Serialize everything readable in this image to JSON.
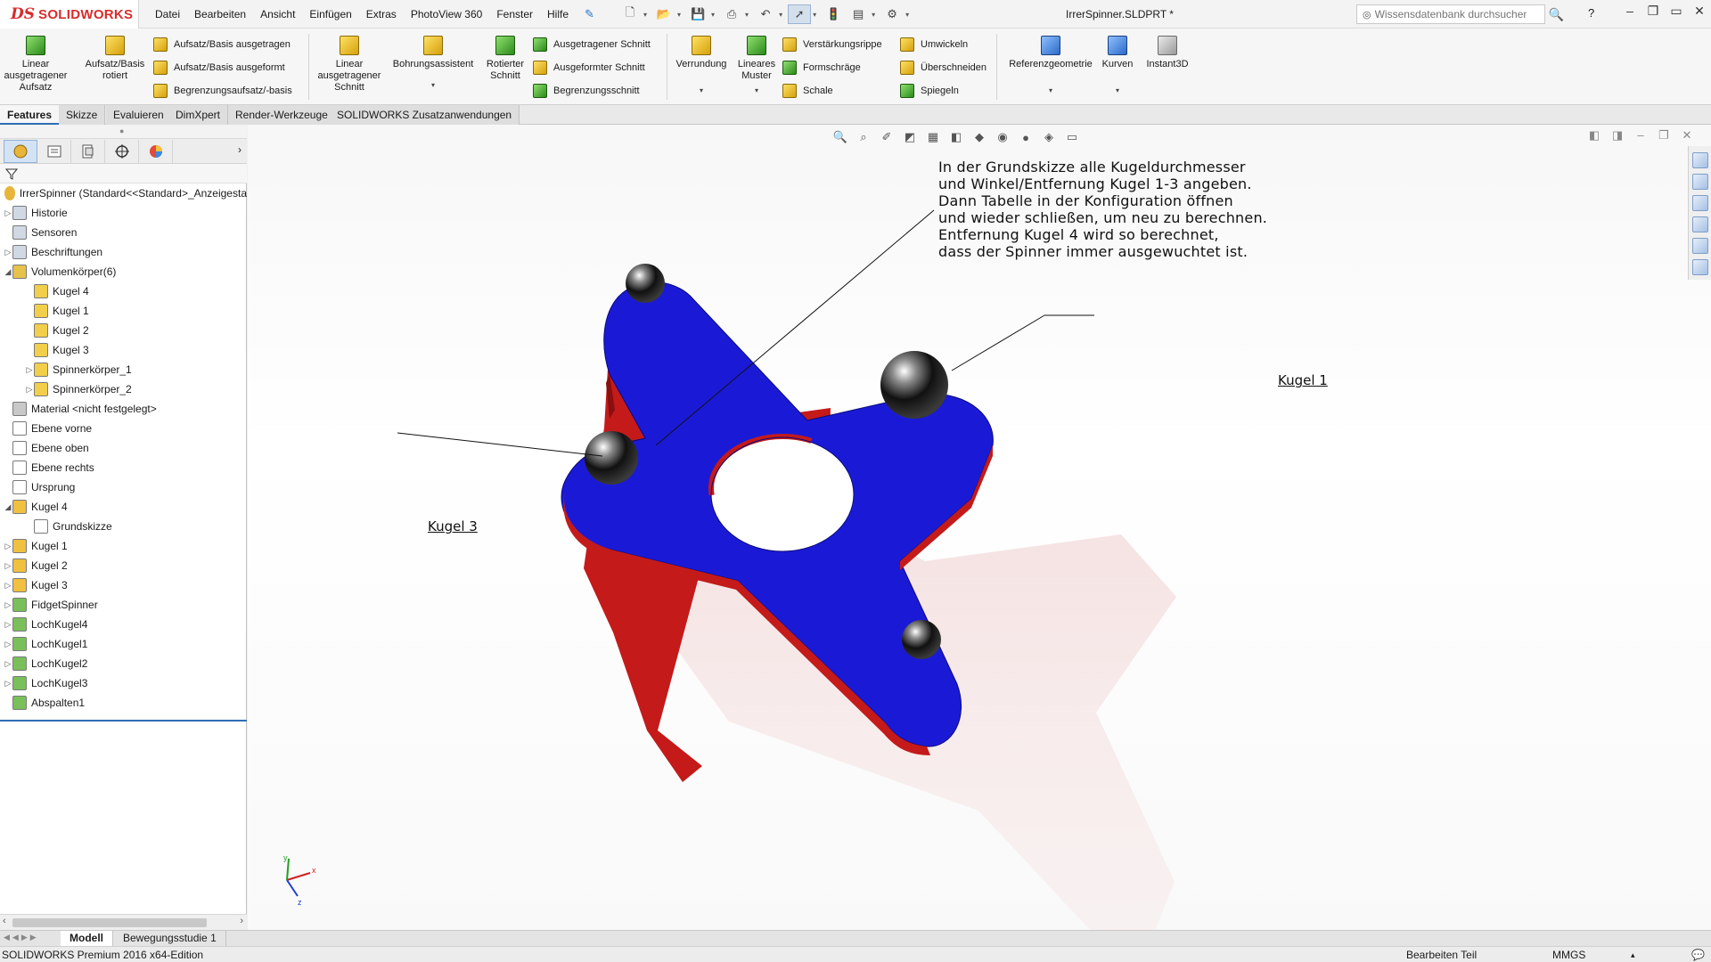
{
  "app": {
    "logo_ds": "DS",
    "logo_text": "SOLIDWORKS",
    "menu": [
      "Datei",
      "Bearbeiten",
      "Ansicht",
      "Einfügen",
      "Extras",
      "PhotoView 360",
      "Fenster",
      "Hilfe"
    ],
    "doc_title": "IrrerSpinner.SLDPRT *",
    "search_placeholder": "Wissensdatenbank durchsuchen",
    "help_label": "?"
  },
  "ribbon": {
    "linear_boss": "Linear ausgetragener Aufsatz",
    "revolve_boss": "Aufsatz/Basis rotiert",
    "sweep_boss": "Aufsatz/Basis ausgetragen",
    "loft_boss": "Aufsatz/Basis ausgeformt",
    "boundary_boss": "Begrenzungsaufsatz/-basis",
    "linear_cut": "Linear ausgetragener Schnitt",
    "hole_wizard": "Bohrungsassistent",
    "revolve_cut": "Rotierter Schnitt",
    "swept_cut": "Ausgetragener Schnitt",
    "lofted_cut": "Ausgeformter Schnitt",
    "boundary_cut": "Begrenzungsschnitt",
    "fillet": "Verrundung",
    "linear_pattern": "Lineares Muster",
    "rib": "Verstärkungsrippe",
    "draft": "Formschräge",
    "shell": "Schale",
    "wrap": "Umwickeln",
    "intersect": "Überschneiden",
    "mirror": "Spiegeln",
    "ref_geometry": "Referenzgeometrie",
    "curves": "Kurven",
    "instant3d": "Instant3D"
  },
  "tabs": [
    "Features",
    "Skizze",
    "Evaluieren",
    "DimXpert",
    "Render-Werkzeuge",
    "SOLIDWORKS Zusatzanwendungen"
  ],
  "tree": {
    "root": "IrrerSpinner  (Standard<<Standard>_Anzeigesta",
    "items": [
      {
        "label": "Historie",
        "indent": 1,
        "exp": "▷",
        "icon": "history-icon",
        "color": "#d0d8e4"
      },
      {
        "label": "Sensoren",
        "indent": 1,
        "exp": "",
        "icon": "sensor-icon",
        "color": "#d0d8e4"
      },
      {
        "label": "Beschriftungen",
        "indent": 1,
        "exp": "▷",
        "icon": "annotation-icon",
        "color": "#d0d8e4"
      },
      {
        "label": "Volumenkörper(6)",
        "indent": 1,
        "exp": "◢",
        "icon": "solid-bodies-icon",
        "color": "#e6c24a"
      },
      {
        "label": "Kugel 4",
        "indent": 2,
        "exp": "",
        "icon": "body-icon",
        "color": "#f2cf4a"
      },
      {
        "label": "Kugel 1",
        "indent": 2,
        "exp": "",
        "icon": "body-icon",
        "color": "#f2cf4a"
      },
      {
        "label": "Kugel 2",
        "indent": 2,
        "exp": "",
        "icon": "body-icon",
        "color": "#f2cf4a"
      },
      {
        "label": "Kugel 3",
        "indent": 2,
        "exp": "",
        "icon": "body-icon",
        "color": "#f2cf4a"
      },
      {
        "label": "Spinnerkörper_1",
        "indent": 2,
        "exp": "▷",
        "icon": "body-icon",
        "color": "#f2cf4a"
      },
      {
        "label": "Spinnerkörper_2",
        "indent": 2,
        "exp": "▷",
        "icon": "body-icon",
        "color": "#f2cf4a"
      },
      {
        "label": "Material <nicht festgelegt>",
        "indent": 1,
        "exp": "",
        "icon": "material-icon",
        "color": "#c8c8c8"
      },
      {
        "label": "Ebene vorne",
        "indent": 1,
        "exp": "",
        "icon": "plane-icon",
        "color": "#ffffff"
      },
      {
        "label": "Ebene oben",
        "indent": 1,
        "exp": "",
        "icon": "plane-icon",
        "color": "#ffffff"
      },
      {
        "label": "Ebene rechts",
        "indent": 1,
        "exp": "",
        "icon": "plane-icon",
        "color": "#ffffff"
      },
      {
        "label": "Ursprung",
        "indent": 1,
        "exp": "",
        "icon": "origin-icon",
        "color": "#ffffff"
      },
      {
        "label": "Kugel 4",
        "indent": 1,
        "exp": "◢",
        "icon": "revolve-icon",
        "color": "#f0c040"
      },
      {
        "label": "Grundskizze",
        "indent": 2,
        "exp": "",
        "icon": "sketch-icon",
        "color": "#ffffff"
      },
      {
        "label": "Kugel 1",
        "indent": 1,
        "exp": "▷",
        "icon": "revolve-icon",
        "color": "#f0c040"
      },
      {
        "label": "Kugel 2",
        "indent": 1,
        "exp": "▷",
        "icon": "revolve-icon",
        "color": "#f0c040"
      },
      {
        "label": "Kugel 3",
        "indent": 1,
        "exp": "▷",
        "icon": "revolve-icon",
        "color": "#f0c040"
      },
      {
        "label": "FidgetSpinner",
        "indent": 1,
        "exp": "▷",
        "icon": "extrude-icon",
        "color": "#7ac05a"
      },
      {
        "label": "LochKugel4",
        "indent": 1,
        "exp": "▷",
        "icon": "cut-icon",
        "color": "#7ac05a"
      },
      {
        "label": "LochKugel1",
        "indent": 1,
        "exp": "▷",
        "icon": "cut-icon",
        "color": "#7ac05a"
      },
      {
        "label": "LochKugel2",
        "indent": 1,
        "exp": "▷",
        "icon": "cut-icon",
        "color": "#7ac05a"
      },
      {
        "label": "LochKugel3",
        "indent": 1,
        "exp": "▷",
        "icon": "cut-icon",
        "color": "#7ac05a"
      },
      {
        "label": "Abspalten1",
        "indent": 1,
        "exp": "",
        "icon": "split-icon",
        "color": "#7ac05a"
      }
    ]
  },
  "viewport": {
    "note_lines": [
      "In der Grundskizze alle Kugeldurchmesser",
      "und Winkel/Entfernung Kugel 1-3 angeben.",
      "Dann Tabelle in der Konfiguration öffnen",
      "und wieder schließen, um neu zu berechnen.",
      "Entfernung Kugel 4 wird so berechnet,",
      "dass der Spinner immer ausgewuchtet ist."
    ],
    "callout_kugel1": "Kugel 1",
    "callout_kugel3": "Kugel 3",
    "body_color": "#1a1ad6",
    "bottom_color": "#c41a1a",
    "triad_x": "x",
    "triad_y": "y",
    "triad_z": "z"
  },
  "bottom_tabs": [
    "Modell",
    "Bewegungsstudie 1"
  ],
  "status": {
    "edition": "SOLIDWORKS Premium 2016 x64-Edition",
    "mode": "Bearbeiten Teil",
    "units": "MMGS"
  }
}
